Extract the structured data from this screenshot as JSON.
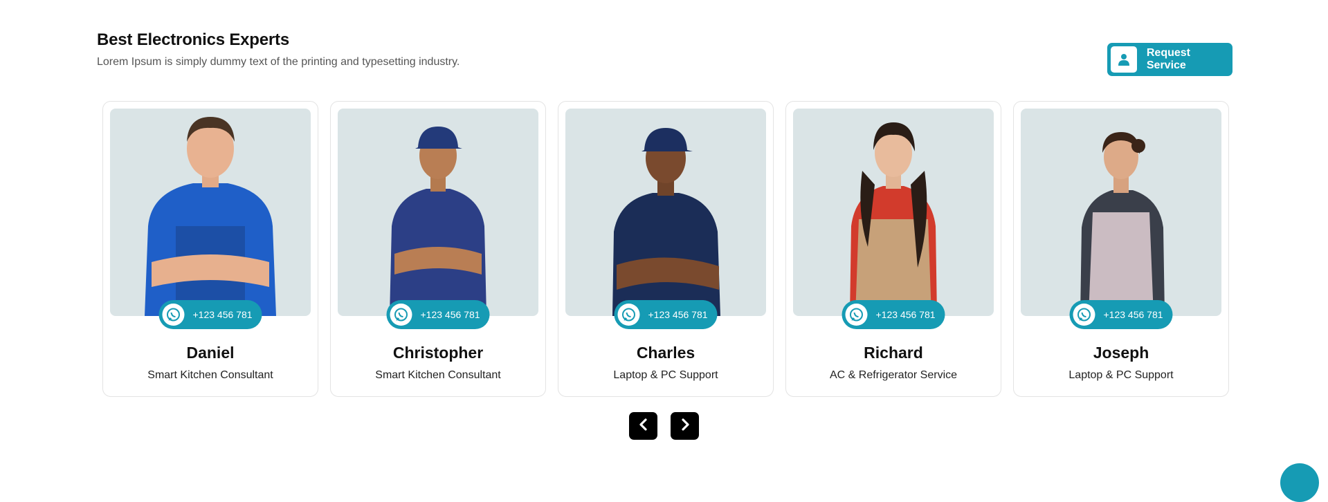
{
  "section": {
    "title": "Best Electronics Experts",
    "subtitle": "Lorem Ipsum is simply dummy text of the printing and typesetting industry."
  },
  "request_button": {
    "label": "Request Service",
    "icon": "user-icon"
  },
  "experts": [
    {
      "name": "Daniel",
      "role": "Smart Kitchen Consultant",
      "phone": "+123 456 781"
    },
    {
      "name": "Christopher",
      "role": "Smart Kitchen Consultant",
      "phone": "+123 456 781"
    },
    {
      "name": "Charles",
      "role": "Laptop & PC Support",
      "phone": "+123 456 781"
    },
    {
      "name": "Richard",
      "role": "AC & Refrigerator Service",
      "phone": "+123 456 781"
    },
    {
      "name": "Joseph",
      "role": "Laptop & PC Support",
      "phone": "+123 456 781"
    }
  ],
  "carousel": {
    "prev_icon": "chevron-left-icon",
    "next_icon": "chevron-right-icon"
  },
  "colors": {
    "accent": "#169bb4",
    "photo_bg": "#dae4e6",
    "nav_bg": "#000000"
  }
}
